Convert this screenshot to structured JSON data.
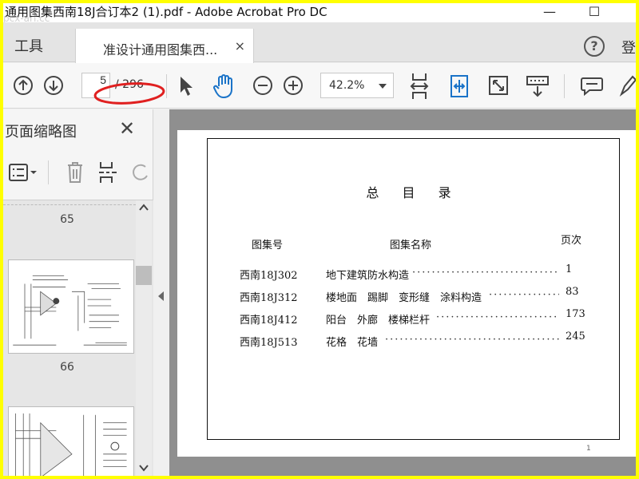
{
  "window": {
    "title": "通用图集西南18J合订本2 (1).pdf - Adobe Acrobat Pro DC",
    "watermark": "pcx-arf.cc",
    "minimize_glyph": "—",
    "maximize_glyph": "☐"
  },
  "tabs": {
    "tools_label": "工具",
    "document_tab_label": "准设计通用图集西...",
    "close_glyph": "×",
    "help_glyph": "?",
    "login_label": "登"
  },
  "toolbar": {
    "current_page": "5",
    "total_pages": "/ 296",
    "zoom_value": "42.2%",
    "icons": [
      "prev-page-icon",
      "next-page-icon",
      "select-cursor-icon",
      "hand-tool-icon",
      "zoom-out-icon",
      "zoom-in-icon",
      "fit-page-icon",
      "fit-width-icon",
      "full-screen-icon",
      "keyboard-scroll-icon",
      "comment-icon",
      "highlight-pen-icon"
    ],
    "accent_color": "#1a73c8",
    "annotation_color": "#e02020"
  },
  "sidebar": {
    "title": "页面缩略图",
    "close_glyph": "✕",
    "thumbnail_labels": [
      "65",
      "66"
    ],
    "tool_icons": [
      "thumbnail-options-icon",
      "delete-page-icon",
      "insert-page-icon",
      "rotate-page-icon"
    ]
  },
  "document": {
    "title": "总 目 录",
    "headers": {
      "code": "图集号",
      "name": "图集名称",
      "page": "页次"
    },
    "rows": [
      {
        "code": "西南18J302",
        "name": "地下建筑防水构造",
        "page": "1"
      },
      {
        "code": "西南18J312",
        "name": "楼地面　踢脚　变形缝　涂料构造",
        "page": "83"
      },
      {
        "code": "西南18J412",
        "name": "阳台　外廊　楼梯栏杆",
        "page": "173"
      },
      {
        "code": "西南18J513",
        "name": "花格　花墙",
        "page": "245"
      }
    ],
    "page_footer": "1"
  }
}
